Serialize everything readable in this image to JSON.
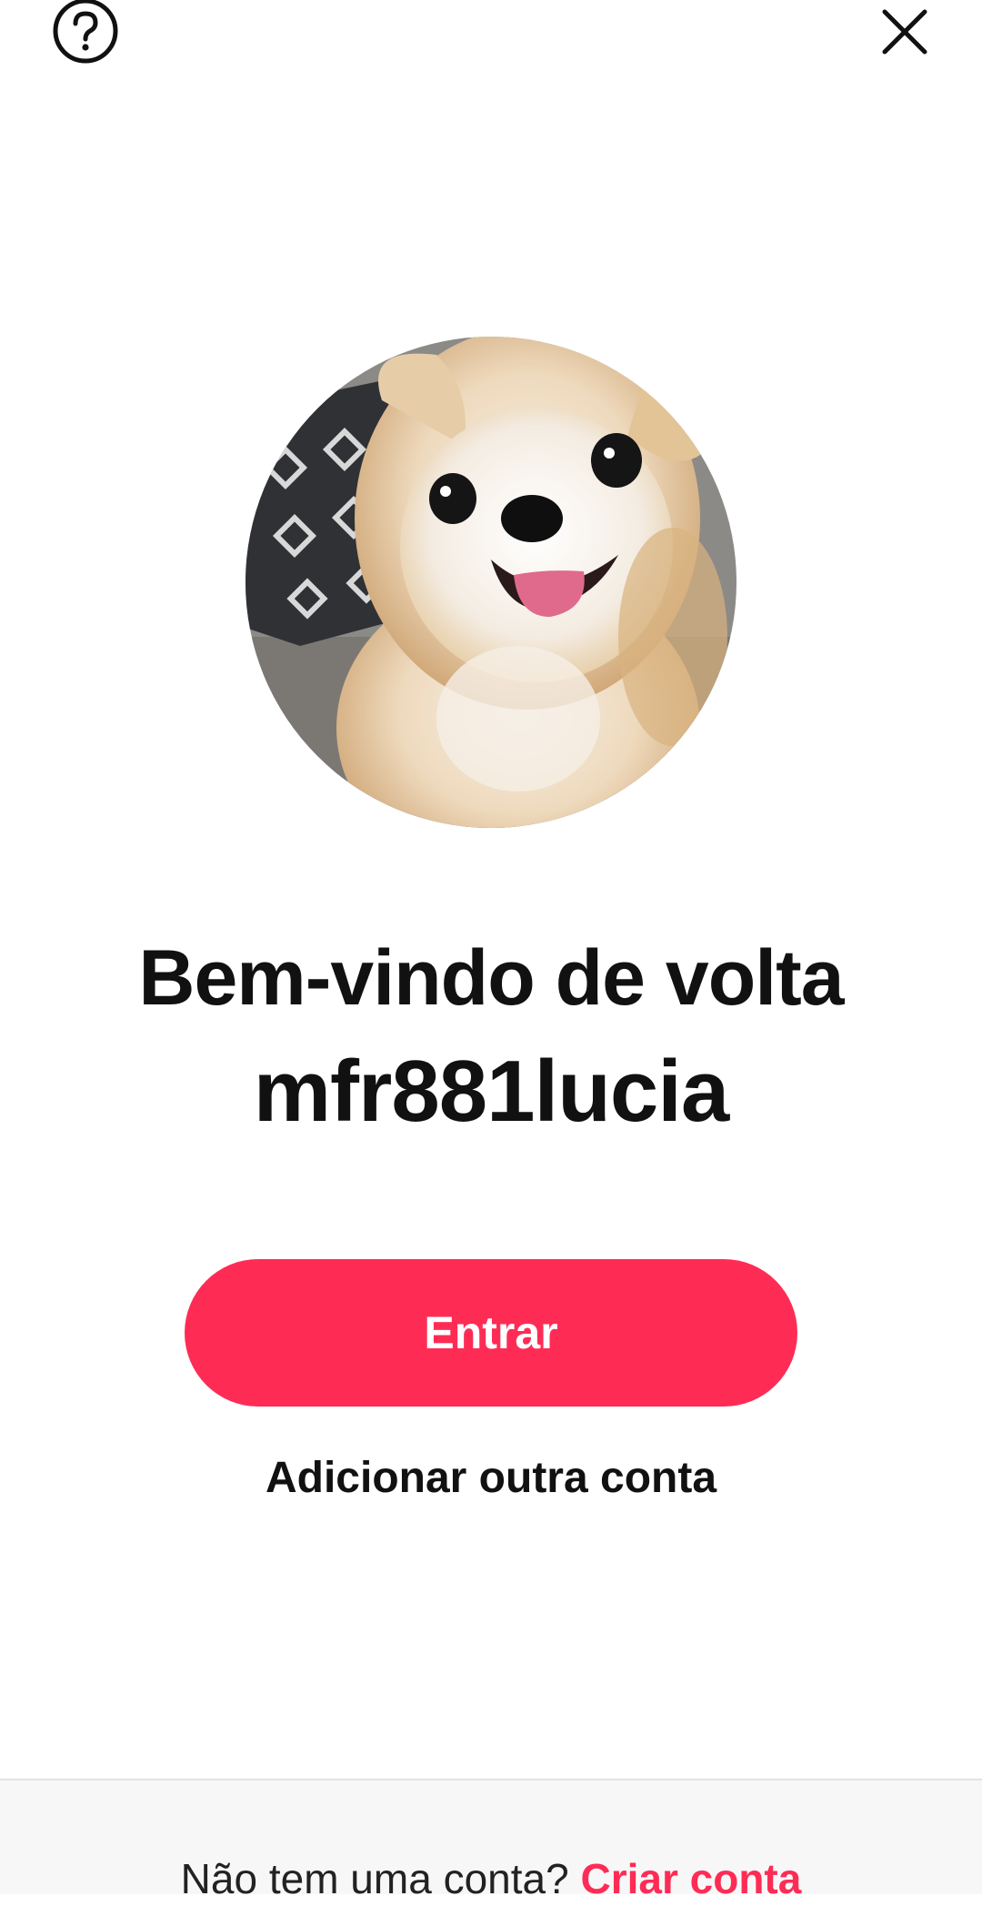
{
  "header": {
    "help_icon": "question-circle-icon",
    "close_icon": "close-icon"
  },
  "profile": {
    "avatar": "dog-photo-avatar",
    "welcome_text": "Bem-vindo de volta",
    "username": "mfr881lucia"
  },
  "actions": {
    "login_label": "Entrar",
    "add_account_label": "Adicionar outra conta"
  },
  "footer": {
    "prompt": "Não tem uma conta? ",
    "signup_label": "Criar conta"
  },
  "colors": {
    "accent": "#fe2c55",
    "footer_bg": "#f7f7f8",
    "text": "#111111"
  }
}
